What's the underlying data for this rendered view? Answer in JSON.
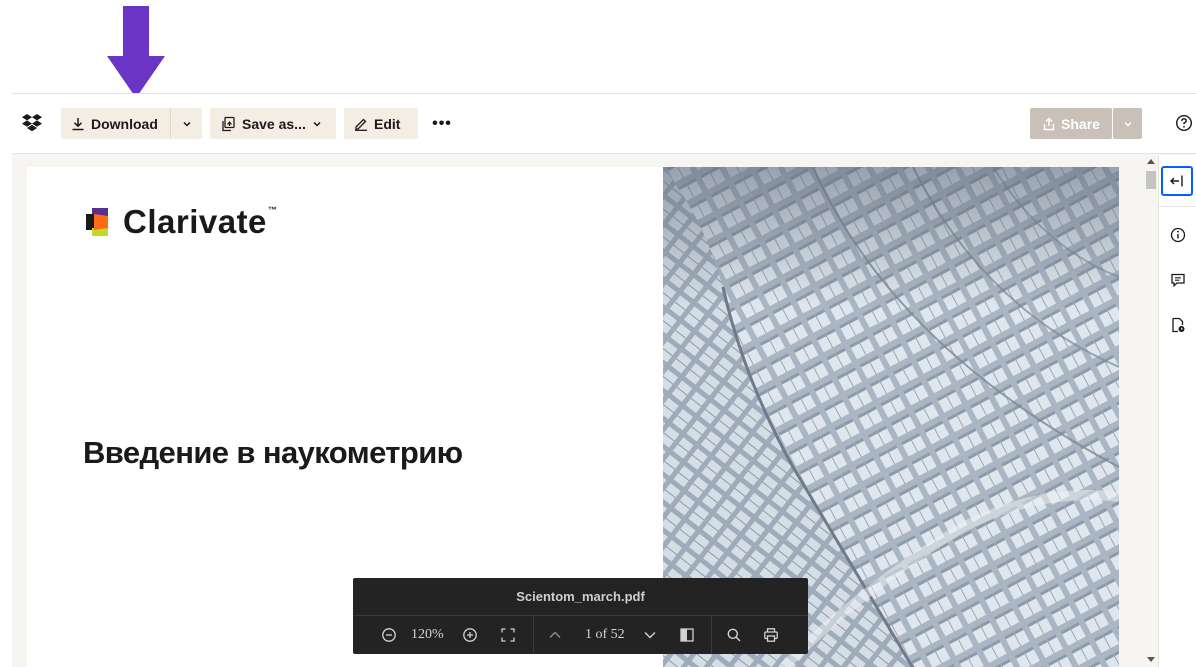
{
  "toolbar": {
    "download_label": "Download",
    "save_as_label": "Save as...",
    "edit_label": "Edit",
    "more_label": "•••",
    "share_label": "Share"
  },
  "document": {
    "brand_name": "Clarivate",
    "brand_trademark": "™",
    "title": "Введение в наукометрию"
  },
  "pdf_controls": {
    "filename": "Scientom_march.pdf",
    "zoom": "120%",
    "page_indicator": "1 of 52"
  },
  "icons": {
    "logo": "dropbox-logo-icon",
    "download": "download-icon",
    "save_as": "save-as-icon",
    "edit": "pencil-icon",
    "share": "share-icon",
    "help": "help-icon",
    "collapse": "collapse-panel-icon",
    "info": "info-icon",
    "comments": "comment-icon",
    "file_activity": "file-activity-icon",
    "zoom_out": "zoom-out-icon",
    "zoom_in": "zoom-in-icon",
    "fullscreen": "fullscreen-icon",
    "prev_page": "chevron-up-icon",
    "next_page": "chevron-down-icon",
    "sidebar": "sidebar-toggle-icon",
    "search": "search-icon",
    "print": "print-icon"
  },
  "colors": {
    "annotation_arrow": "#6a35c4",
    "toolbar_button_bg": "#f3ede4",
    "share_button_bg": "#c9c1b8",
    "accent_blue": "#0061fe",
    "pdf_bar_bg": "#232323"
  }
}
